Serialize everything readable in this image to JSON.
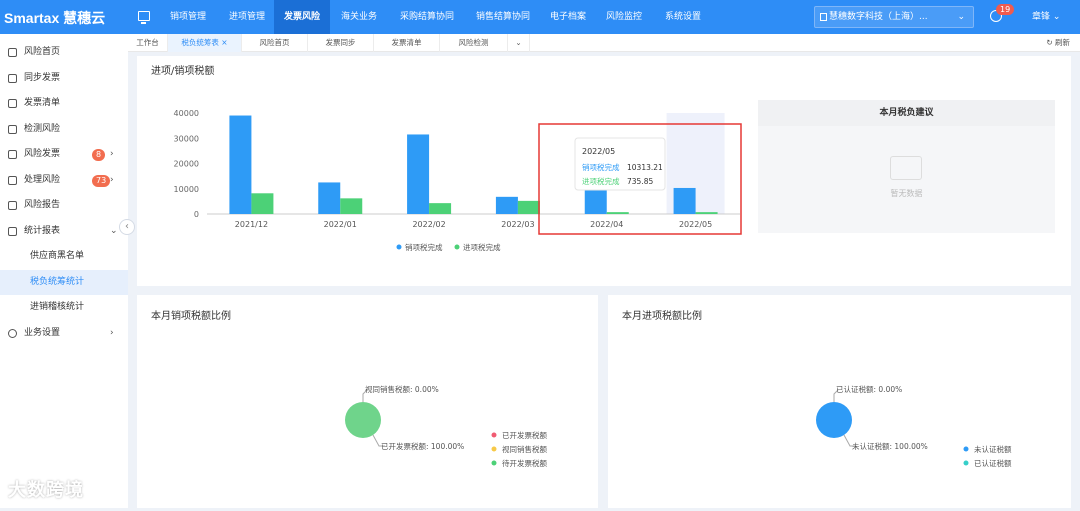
{
  "app": {
    "logo": "Smartax 慧穗云",
    "company": "慧穗数字科技（上海）...",
    "user": "章锋",
    "bell_count": "19"
  },
  "nav": [
    "销项管理",
    "进项管理",
    "发票风险",
    "海关业务",
    "采购结算协同",
    "销售结算协同",
    "电子档案",
    "风险监控",
    "系统设置"
  ],
  "nav_active": 2,
  "sidebar": {
    "items": [
      {
        "label": "风险首页",
        "icon": "home-icon"
      },
      {
        "label": "同步发票",
        "icon": "sync-icon"
      },
      {
        "label": "发票清单",
        "icon": "list-icon"
      },
      {
        "label": "检测风险",
        "icon": "check-icon"
      },
      {
        "label": "风险发票",
        "icon": "fire-icon",
        "badge": "8"
      },
      {
        "label": "处理风险",
        "icon": "handle-icon",
        "badge": "73"
      },
      {
        "label": "风险报告",
        "icon": "report-icon"
      },
      {
        "label": "统计报表",
        "icon": "clock-icon"
      }
    ],
    "sub_items": [
      "供应商黑名单",
      "税负统筹统计",
      "进销稽核统计"
    ],
    "sub_active": 1,
    "last": {
      "label": "业务设置",
      "icon": "settings-icon"
    }
  },
  "tabs": [
    "工作台",
    "税负统筹表",
    "风险首页",
    "发票同步",
    "发票清单",
    "风险检测"
  ],
  "tab_active": 1,
  "refresh": "刷新",
  "chart_data": {
    "type": "bar",
    "title": "进项/销项税额",
    "categories": [
      "2021/12",
      "2022/01",
      "2022/02",
      "2022/03",
      "2022/04",
      "2022/05"
    ],
    "series": [
      {
        "name": "销项税完成",
        "color": "#2e9bf6",
        "values": [
          39000,
          12500,
          31500,
          6800,
          10313.21,
          10313.21
        ]
      },
      {
        "name": "进项税完成",
        "color": "#4cd177",
        "values": [
          8200,
          6200,
          4300,
          5200,
          735.85,
          735.85
        ]
      }
    ],
    "ylim": [
      0,
      40000
    ],
    "yticks": [
      "0",
      "10000",
      "20000",
      "30000",
      "40000"
    ],
    "tooltip": {
      "title": "2022/05",
      "line1_label": "销项税完成",
      "line1_value": "10313.21",
      "line2_label": "进项税完成",
      "line2_value": "735.85"
    }
  },
  "advice": {
    "title": "本月税负建议",
    "empty": "暂无数据"
  },
  "pie_sales": {
    "title": "本月销项税额比例",
    "label_top": "视同销售税额: 0.00%",
    "label_bottom": "已开发票税额: 100.00%",
    "legend": [
      {
        "name": "已开发票税额",
        "color": "#f05b72"
      },
      {
        "name": "视同销售税额",
        "color": "#f7c948"
      },
      {
        "name": "待开发票税额",
        "color": "#4cd177"
      }
    ]
  },
  "pie_input": {
    "title": "本月进项税额比例",
    "label_top": "已认证税额: 0.00%",
    "label_bottom": "未认证税额: 100.00%",
    "legend": [
      {
        "name": "未认证税额",
        "color": "#2e9bf6"
      },
      {
        "name": "已认证税额",
        "color": "#36cfc9"
      }
    ]
  },
  "watermark": "大数跨境"
}
